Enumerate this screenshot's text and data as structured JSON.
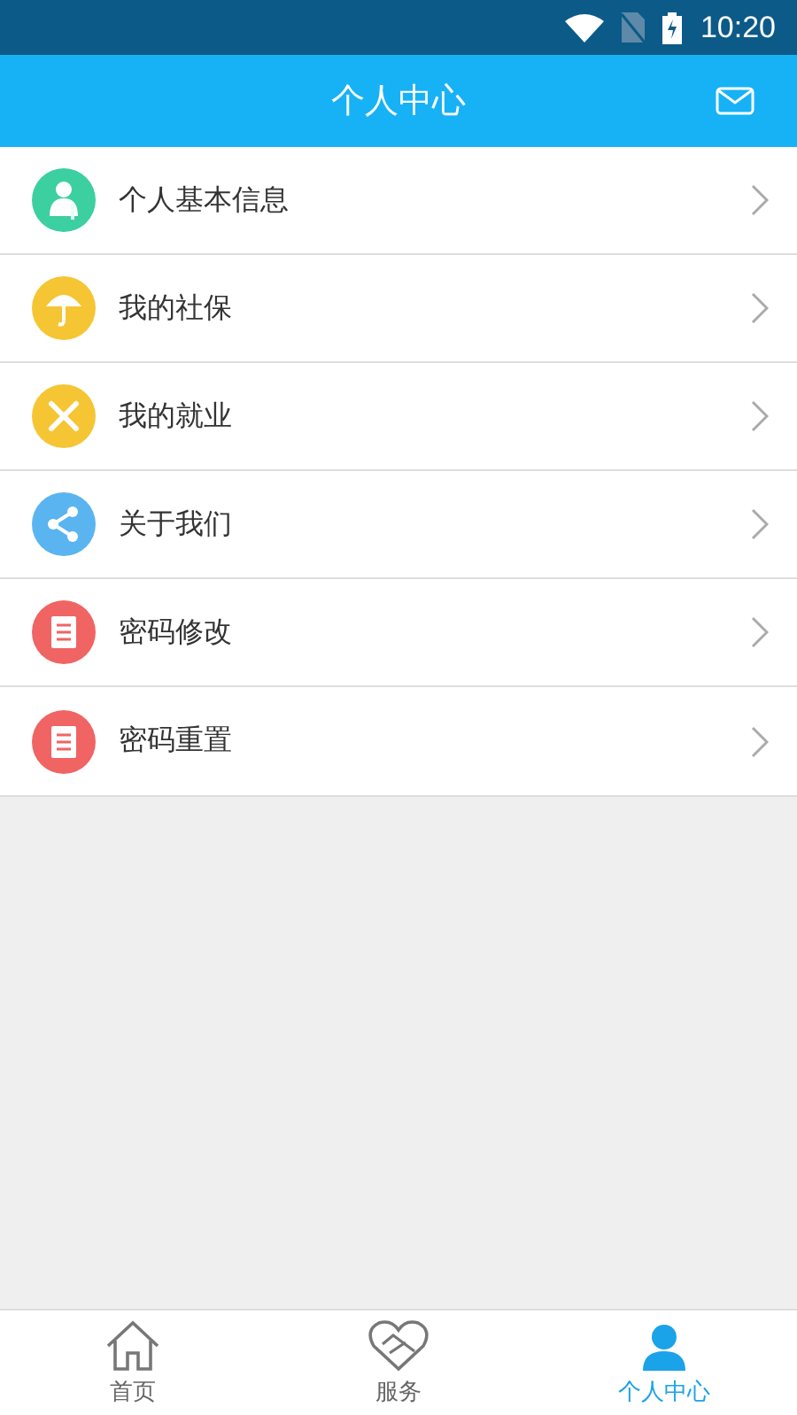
{
  "status_bar": {
    "time": "10:20"
  },
  "header": {
    "title": "个人中心"
  },
  "menu": [
    {
      "label": "个人基本信息",
      "color": "#3ccfa0"
    },
    {
      "label": "我的社保",
      "color": "#f6c533"
    },
    {
      "label": "我的就业",
      "color": "#f6c533"
    },
    {
      "label": "关于我们",
      "color": "#5ab4f0"
    },
    {
      "label": "密码修改",
      "color": "#f06464"
    },
    {
      "label": "密码重置",
      "color": "#f06464"
    }
  ],
  "tab_bar": [
    {
      "label": "首页",
      "selected": false
    },
    {
      "label": "服务",
      "selected": false
    },
    {
      "label": "个人中心",
      "selected": true
    }
  ]
}
